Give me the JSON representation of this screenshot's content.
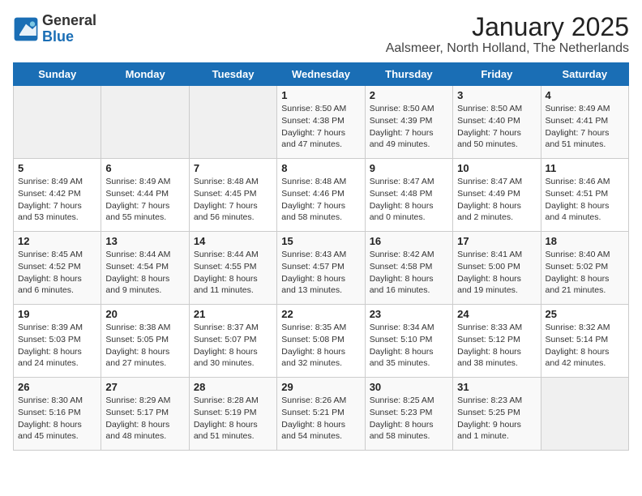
{
  "header": {
    "logo_general": "General",
    "logo_blue": "Blue",
    "title": "January 2025",
    "subtitle": "Aalsmeer, North Holland, The Netherlands"
  },
  "days_of_week": [
    "Sunday",
    "Monday",
    "Tuesday",
    "Wednesday",
    "Thursday",
    "Friday",
    "Saturday"
  ],
  "weeks": [
    [
      {
        "day": "",
        "info": ""
      },
      {
        "day": "",
        "info": ""
      },
      {
        "day": "",
        "info": ""
      },
      {
        "day": "1",
        "info": "Sunrise: 8:50 AM\nSunset: 4:38 PM\nDaylight: 7 hours\nand 47 minutes."
      },
      {
        "day": "2",
        "info": "Sunrise: 8:50 AM\nSunset: 4:39 PM\nDaylight: 7 hours\nand 49 minutes."
      },
      {
        "day": "3",
        "info": "Sunrise: 8:50 AM\nSunset: 4:40 PM\nDaylight: 7 hours\nand 50 minutes."
      },
      {
        "day": "4",
        "info": "Sunrise: 8:49 AM\nSunset: 4:41 PM\nDaylight: 7 hours\nand 51 minutes."
      }
    ],
    [
      {
        "day": "5",
        "info": "Sunrise: 8:49 AM\nSunset: 4:42 PM\nDaylight: 7 hours\nand 53 minutes."
      },
      {
        "day": "6",
        "info": "Sunrise: 8:49 AM\nSunset: 4:44 PM\nDaylight: 7 hours\nand 55 minutes."
      },
      {
        "day": "7",
        "info": "Sunrise: 8:48 AM\nSunset: 4:45 PM\nDaylight: 7 hours\nand 56 minutes."
      },
      {
        "day": "8",
        "info": "Sunrise: 8:48 AM\nSunset: 4:46 PM\nDaylight: 7 hours\nand 58 minutes."
      },
      {
        "day": "9",
        "info": "Sunrise: 8:47 AM\nSunset: 4:48 PM\nDaylight: 8 hours\nand 0 minutes."
      },
      {
        "day": "10",
        "info": "Sunrise: 8:47 AM\nSunset: 4:49 PM\nDaylight: 8 hours\nand 2 minutes."
      },
      {
        "day": "11",
        "info": "Sunrise: 8:46 AM\nSunset: 4:51 PM\nDaylight: 8 hours\nand 4 minutes."
      }
    ],
    [
      {
        "day": "12",
        "info": "Sunrise: 8:45 AM\nSunset: 4:52 PM\nDaylight: 8 hours\nand 6 minutes."
      },
      {
        "day": "13",
        "info": "Sunrise: 8:44 AM\nSunset: 4:54 PM\nDaylight: 8 hours\nand 9 minutes."
      },
      {
        "day": "14",
        "info": "Sunrise: 8:44 AM\nSunset: 4:55 PM\nDaylight: 8 hours\nand 11 minutes."
      },
      {
        "day": "15",
        "info": "Sunrise: 8:43 AM\nSunset: 4:57 PM\nDaylight: 8 hours\nand 13 minutes."
      },
      {
        "day": "16",
        "info": "Sunrise: 8:42 AM\nSunset: 4:58 PM\nDaylight: 8 hours\nand 16 minutes."
      },
      {
        "day": "17",
        "info": "Sunrise: 8:41 AM\nSunset: 5:00 PM\nDaylight: 8 hours\nand 19 minutes."
      },
      {
        "day": "18",
        "info": "Sunrise: 8:40 AM\nSunset: 5:02 PM\nDaylight: 8 hours\nand 21 minutes."
      }
    ],
    [
      {
        "day": "19",
        "info": "Sunrise: 8:39 AM\nSunset: 5:03 PM\nDaylight: 8 hours\nand 24 minutes."
      },
      {
        "day": "20",
        "info": "Sunrise: 8:38 AM\nSunset: 5:05 PM\nDaylight: 8 hours\nand 27 minutes."
      },
      {
        "day": "21",
        "info": "Sunrise: 8:37 AM\nSunset: 5:07 PM\nDaylight: 8 hours\nand 30 minutes."
      },
      {
        "day": "22",
        "info": "Sunrise: 8:35 AM\nSunset: 5:08 PM\nDaylight: 8 hours\nand 32 minutes."
      },
      {
        "day": "23",
        "info": "Sunrise: 8:34 AM\nSunset: 5:10 PM\nDaylight: 8 hours\nand 35 minutes."
      },
      {
        "day": "24",
        "info": "Sunrise: 8:33 AM\nSunset: 5:12 PM\nDaylight: 8 hours\nand 38 minutes."
      },
      {
        "day": "25",
        "info": "Sunrise: 8:32 AM\nSunset: 5:14 PM\nDaylight: 8 hours\nand 42 minutes."
      }
    ],
    [
      {
        "day": "26",
        "info": "Sunrise: 8:30 AM\nSunset: 5:16 PM\nDaylight: 8 hours\nand 45 minutes."
      },
      {
        "day": "27",
        "info": "Sunrise: 8:29 AM\nSunset: 5:17 PM\nDaylight: 8 hours\nand 48 minutes."
      },
      {
        "day": "28",
        "info": "Sunrise: 8:28 AM\nSunset: 5:19 PM\nDaylight: 8 hours\nand 51 minutes."
      },
      {
        "day": "29",
        "info": "Sunrise: 8:26 AM\nSunset: 5:21 PM\nDaylight: 8 hours\nand 54 minutes."
      },
      {
        "day": "30",
        "info": "Sunrise: 8:25 AM\nSunset: 5:23 PM\nDaylight: 8 hours\nand 58 minutes."
      },
      {
        "day": "31",
        "info": "Sunrise: 8:23 AM\nSunset: 5:25 PM\nDaylight: 9 hours\nand 1 minute."
      },
      {
        "day": "",
        "info": ""
      }
    ]
  ]
}
